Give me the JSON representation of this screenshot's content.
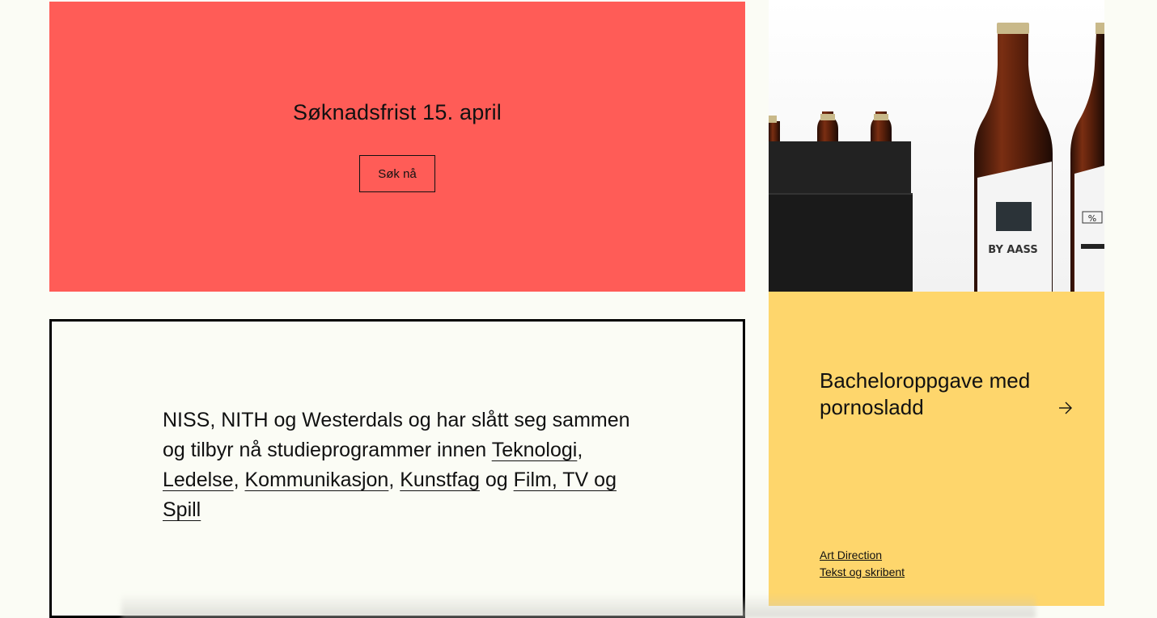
{
  "promo": {
    "title": "Søknadsfrist 15. april",
    "button_label": "Søk nå"
  },
  "card": {
    "title": "Bacheloroppgave med pornosladd",
    "tags": [
      "Art Direction",
      "Tekst og skribent"
    ]
  },
  "photo": {
    "label_text": "BY AASS",
    "percent_text": "%"
  },
  "info": {
    "intro": "NISS, NITH og Westerdals og har slått seg sammen og tilbyr nå studieprogrammer innen ",
    "links": [
      "Teknologi",
      "Ledelse",
      "Kommunikasjon",
      "Kunstfag",
      "Film, TV og Spill"
    ],
    "sep1": ", ",
    "sep2": ", ",
    "sep3": ", ",
    "conj": " og "
  },
  "colors": {
    "promo_bg": "#ff5c57",
    "card_bg": "#fed66c",
    "page_bg": "#fbfcf5"
  }
}
